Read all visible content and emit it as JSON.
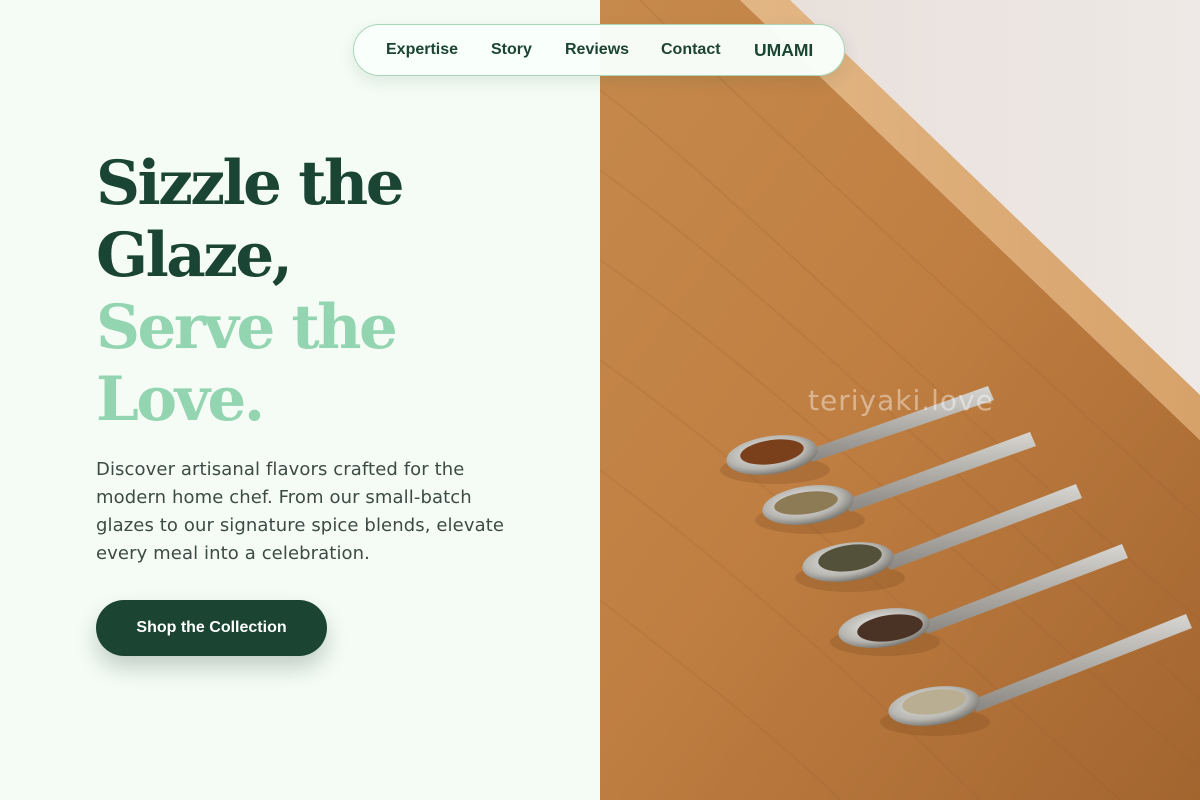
{
  "nav": {
    "items": [
      {
        "label": "Expertise"
      },
      {
        "label": "Story"
      },
      {
        "label": "Reviews"
      },
      {
        "label": "Contact"
      }
    ],
    "brand": "UMAMI"
  },
  "hero": {
    "title_line1": "Sizzle the",
    "title_line2": "Glaze,",
    "title_line3": "Serve the",
    "title_line4": "Love.",
    "subtitle": "Discover artisanal flavors crafted for the modern home chef. From our small-batch glazes to our signature spice blends, elevate every meal into a celebration.",
    "cta_label": "Shop the Collection"
  },
  "image": {
    "watermark": "teriyaki.love"
  },
  "colors": {
    "primary": "#1b4433",
    "accent_mint": "#93d4b1",
    "background": "#f4fcf5"
  }
}
